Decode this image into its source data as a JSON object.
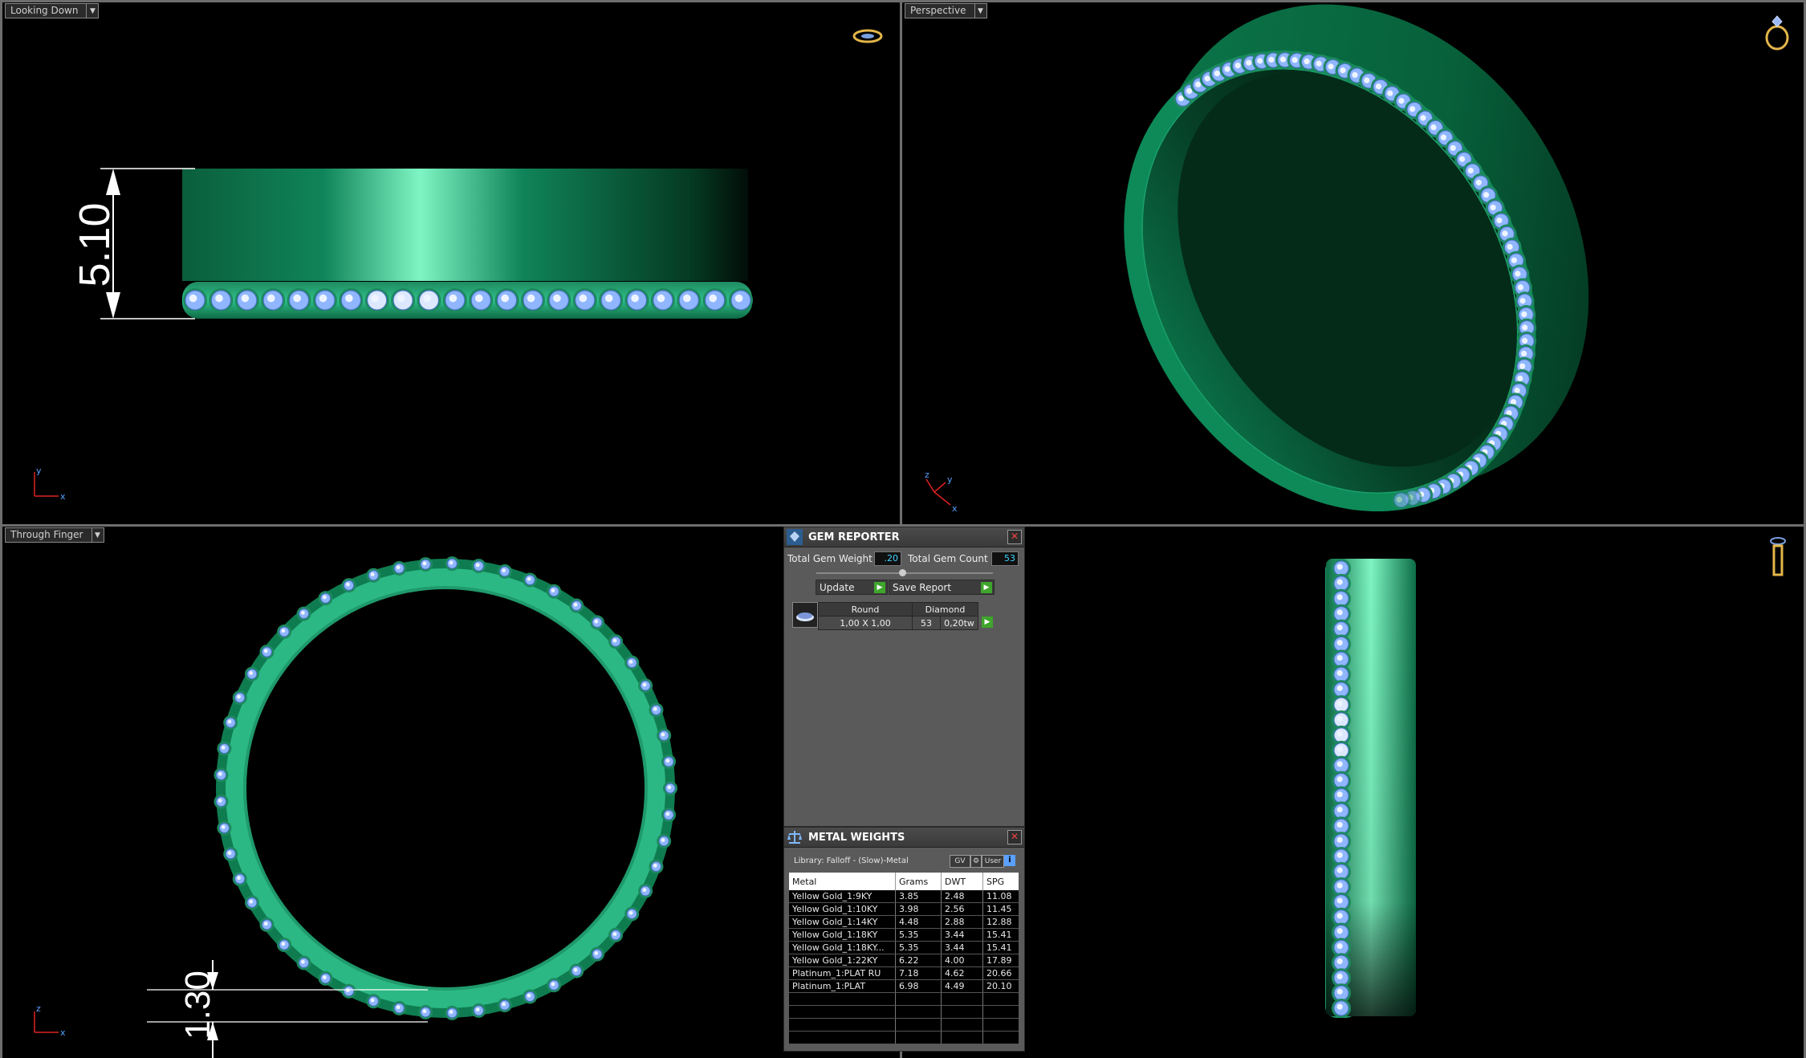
{
  "viewports": {
    "top_left": {
      "label": "Looking Down",
      "dimension": "5.10"
    },
    "top_right": {
      "label": "Perspective"
    },
    "bottom_left": {
      "label": "Through Finger",
      "dimension": "1.30"
    },
    "bottom_right": {
      "label": ""
    }
  },
  "axes": {
    "x": "x",
    "y": "y",
    "z": "z"
  },
  "gem_reporter": {
    "title": "GEM REPORTER",
    "total_weight_label": "Total Gem Weight",
    "total_weight_value": ".20",
    "total_count_label": "Total Gem Count",
    "total_count_value": "53",
    "update_label": "Update",
    "save_label": "Save Report",
    "gem": {
      "shape": "Round",
      "material": "Diamond",
      "size": "1,00 X 1,00",
      "count": "53",
      "weight": "0,20tw"
    }
  },
  "metal_weights": {
    "title": "METAL WEIGHTS",
    "library": "Library: Falloff - (Slow)-Metal",
    "btn_gv": "GV",
    "btn_user": "User",
    "columns": [
      "Metal",
      "Grams",
      "DWT",
      "SPG"
    ],
    "rows": [
      [
        "Yellow Gold_1:9KY",
        "3.85",
        "2.48",
        "11.08"
      ],
      [
        "Yellow Gold_1:10KY",
        "3.98",
        "2.56",
        "11.45"
      ],
      [
        "Yellow Gold_1:14KY",
        "4.48",
        "2.88",
        "12.88"
      ],
      [
        "Yellow Gold_1:18KY",
        "5.35",
        "3.44",
        "15.41"
      ],
      [
        "Yellow Gold_1:18KY...",
        "5.35",
        "3.44",
        "15.41"
      ],
      [
        "Yellow Gold_1:22KY",
        "6.22",
        "4.00",
        "17.89"
      ],
      [
        "Platinum_1:PLAT RU",
        "7.18",
        "4.62",
        "20.66"
      ],
      [
        "Platinum_1:PLAT",
        "6.98",
        "4.49",
        "20.10"
      ]
    ]
  },
  "colors": {
    "band": "#0c7a4c",
    "band_highlight": "#7ef5c2",
    "gem": "#8fb6ff",
    "background": "#000000"
  }
}
